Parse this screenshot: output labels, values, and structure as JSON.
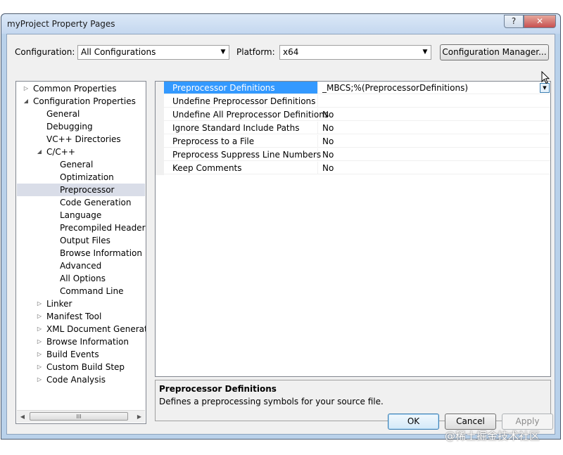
{
  "window": {
    "title": "myProject Property Pages",
    "help_glyph": "?",
    "close_glyph": "✕"
  },
  "config_bar": {
    "configuration_label": "Configuration:",
    "configuration_value": "All Configurations",
    "platform_label": "Platform:",
    "platform_value": "x64",
    "manager_button": "Configuration Manager..."
  },
  "tree": {
    "items": [
      {
        "label": "Common Properties",
        "level": 0,
        "expander": "collapsed"
      },
      {
        "label": "Configuration Properties",
        "level": 0,
        "expander": "expanded"
      },
      {
        "label": "General",
        "level": 1,
        "expander": "none"
      },
      {
        "label": "Debugging",
        "level": 1,
        "expander": "none"
      },
      {
        "label": "VC++ Directories",
        "level": 1,
        "expander": "none"
      },
      {
        "label": "C/C++",
        "level": 1,
        "expander": "expanded"
      },
      {
        "label": "General",
        "level": 2,
        "expander": "none"
      },
      {
        "label": "Optimization",
        "level": 2,
        "expander": "none"
      },
      {
        "label": "Preprocessor",
        "level": 2,
        "expander": "none",
        "selected": true
      },
      {
        "label": "Code Generation",
        "level": 2,
        "expander": "none"
      },
      {
        "label": "Language",
        "level": 2,
        "expander": "none"
      },
      {
        "label": "Precompiled Headers",
        "level": 2,
        "expander": "none"
      },
      {
        "label": "Output Files",
        "level": 2,
        "expander": "none"
      },
      {
        "label": "Browse Information",
        "level": 2,
        "expander": "none"
      },
      {
        "label": "Advanced",
        "level": 2,
        "expander": "none"
      },
      {
        "label": "All Options",
        "level": 2,
        "expander": "none"
      },
      {
        "label": "Command Line",
        "level": 2,
        "expander": "none"
      },
      {
        "label": "Linker",
        "level": 1,
        "expander": "collapsed"
      },
      {
        "label": "Manifest Tool",
        "level": 1,
        "expander": "collapsed"
      },
      {
        "label": "XML Document Generator",
        "level": 1,
        "expander": "collapsed"
      },
      {
        "label": "Browse Information",
        "level": 1,
        "expander": "collapsed"
      },
      {
        "label": "Build Events",
        "level": 1,
        "expander": "collapsed"
      },
      {
        "label": "Custom Build Step",
        "level": 1,
        "expander": "collapsed"
      },
      {
        "label": "Code Analysis",
        "level": 1,
        "expander": "collapsed"
      }
    ],
    "scroll_grip": "III"
  },
  "properties": [
    {
      "name": "Preprocessor Definitions",
      "value": "_MBCS;%(PreprocessorDefinitions)",
      "selected": true
    },
    {
      "name": "Undefine Preprocessor Definitions",
      "value": ""
    },
    {
      "name": "Undefine All Preprocessor Definitions",
      "value": "No"
    },
    {
      "name": "Ignore Standard Include Paths",
      "value": "No"
    },
    {
      "name": "Preprocess to a File",
      "value": "No"
    },
    {
      "name": "Preprocess Suppress Line Numbers",
      "value": "No"
    },
    {
      "name": "Keep Comments",
      "value": "No"
    }
  ],
  "description": {
    "title": "Preprocessor Definitions",
    "text": "Defines a preprocessing symbols for your source file."
  },
  "buttons": {
    "ok": "OK",
    "cancel": "Cancel",
    "apply": "Apply"
  },
  "icons": {
    "dropdown": "chevron-down-icon",
    "expander_collapsed": "triangle-right-icon",
    "expander_expanded": "triangle-down-right-icon"
  },
  "colors": {
    "selection": "#3399ff",
    "tree_selection": "#d9dde8"
  },
  "watermark": "@稀土掘金技术社区"
}
